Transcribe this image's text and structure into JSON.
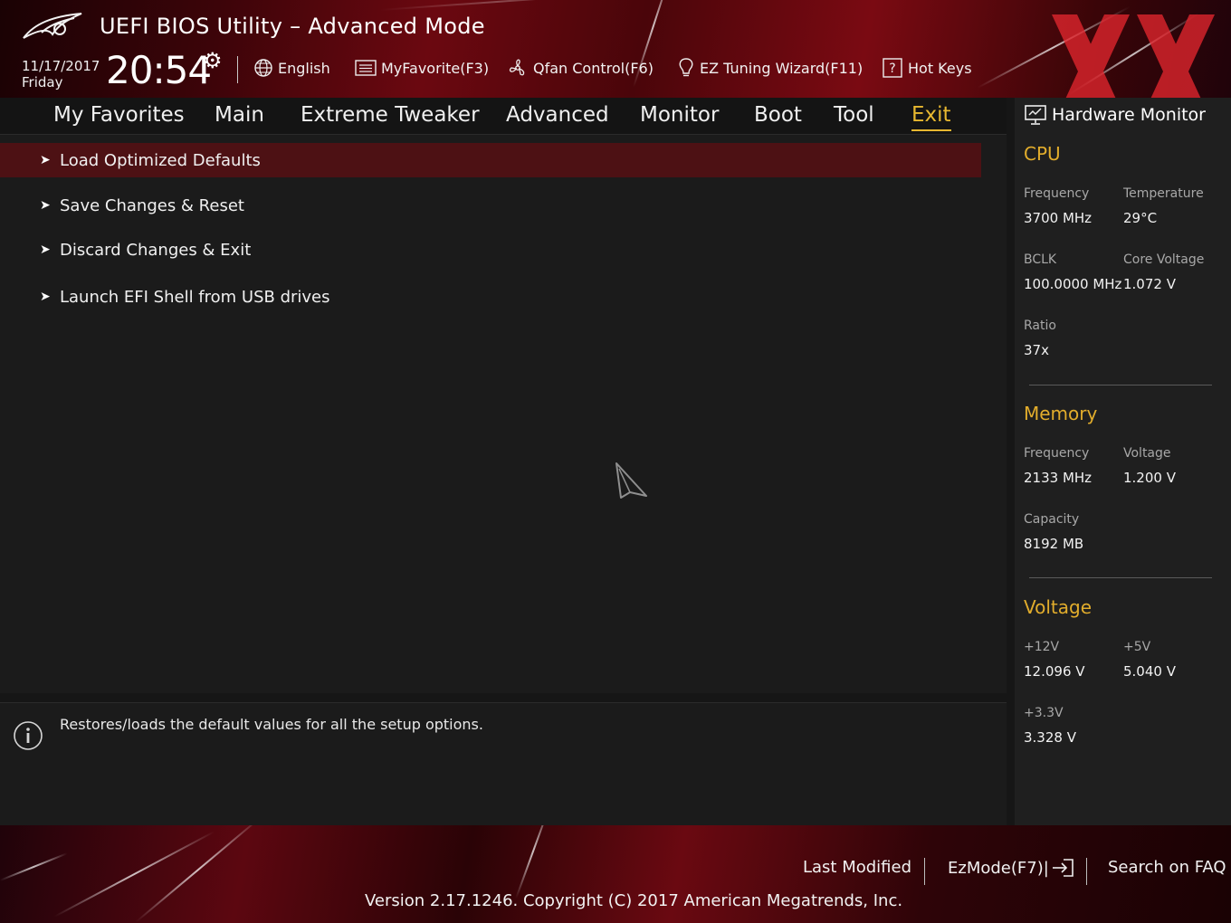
{
  "header": {
    "title": "UEFI BIOS Utility – Advanced Mode",
    "date": "11/17/2017",
    "day": "Friday",
    "time": "20:54",
    "tools": {
      "language": "English",
      "my_favorite": "MyFavorite(F3)",
      "qfan": "Qfan Control(F6)",
      "ez_tuning": "EZ Tuning Wizard(F11)",
      "hot_keys": "Hot Keys"
    }
  },
  "nav": {
    "tabs": [
      "My Favorites",
      "Main",
      "Extreme Tweaker",
      "Advanced",
      "Monitor",
      "Boot",
      "Tool",
      "Exit"
    ],
    "active": "Exit"
  },
  "menu": {
    "items": [
      "Load Optimized Defaults",
      "Save Changes & Reset",
      "Discard Changes & Exit",
      "Launch EFI Shell from USB drives"
    ],
    "selected_index": 0
  },
  "help": {
    "text": "Restores/loads the default values for all the setup options."
  },
  "hardware_monitor": {
    "title": "Hardware Monitor",
    "cpu": {
      "title": "CPU",
      "frequency_label": "Frequency",
      "frequency": "3700 MHz",
      "temperature_label": "Temperature",
      "temperature": "29°C",
      "bclk_label": "BCLK",
      "bclk": "100.0000 MHz",
      "core_voltage_label": "Core Voltage",
      "core_voltage": "1.072 V",
      "ratio_label": "Ratio",
      "ratio": "37x"
    },
    "memory": {
      "title": "Memory",
      "frequency_label": "Frequency",
      "frequency": "2133 MHz",
      "voltage_label": "Voltage",
      "voltage": "1.200 V",
      "capacity_label": "Capacity",
      "capacity": "8192 MB"
    },
    "voltage": {
      "title": "Voltage",
      "v12_label": "+12V",
      "v12": "12.096 V",
      "v5_label": "+5V",
      "v5": "5.040 V",
      "v33_label": "+3.3V",
      "v33": "3.328 V"
    }
  },
  "footer": {
    "last_modified": "Last Modified",
    "ezmode": "EzMode(F7)|",
    "search_faq": "Search on FAQ",
    "version": "Version 2.17.1246. Copyright (C) 2017 American Megatrends, Inc."
  },
  "colors": {
    "accent": "#e2ad2c",
    "active_tab": "#e8b830",
    "selected_row": "#4d1114",
    "brand_red": "#6b0810"
  },
  "icons": {
    "logo": "rog-logo-icon",
    "settings": "gear-icon",
    "language": "globe-icon",
    "favorite": "keyboard-list-icon",
    "qfan": "fan-icon",
    "ez_tuning": "lightbulb-icon",
    "hot_keys": "question-box-icon",
    "monitor": "monitor-icon",
    "info": "info-icon",
    "ezmode": "exit-arrow-icon",
    "watermark": "xx-watermark-icon"
  }
}
